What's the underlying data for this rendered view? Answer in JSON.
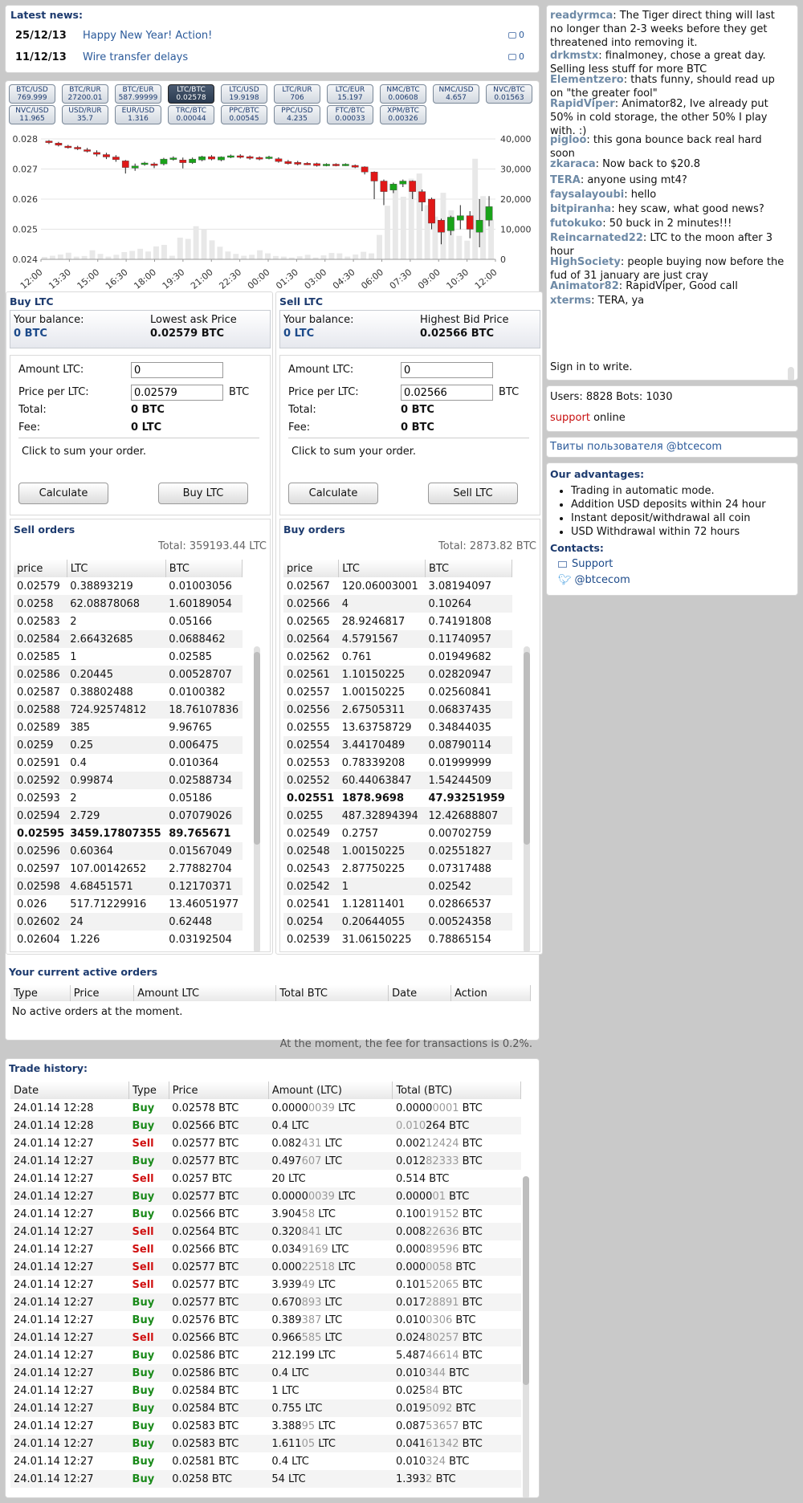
{
  "news": {
    "title": "Latest news:",
    "items": [
      {
        "date": "25/12/13",
        "text": "Happy New Year! Action!",
        "comments": "0"
      },
      {
        "date": "11/12/13",
        "text": "Wire transfer delays",
        "comments": "0"
      }
    ]
  },
  "pairs": [
    {
      "name": "BTC/USD",
      "price": "769.999"
    },
    {
      "name": "BTC/RUR",
      "price": "27200.01"
    },
    {
      "name": "BTC/EUR",
      "price": "587.99999"
    },
    {
      "name": "LTC/BTC",
      "price": "0.02578",
      "active": true
    },
    {
      "name": "LTC/USD",
      "price": "19.9198"
    },
    {
      "name": "LTC/RUR",
      "price": "706"
    },
    {
      "name": "LTC/EUR",
      "price": "15.197"
    },
    {
      "name": "NMC/BTC",
      "price": "0.00608"
    },
    {
      "name": "NMC/USD",
      "price": "4.657"
    },
    {
      "name": "NVC/BTC",
      "price": "0.01563"
    },
    {
      "name": "NVC/USD",
      "price": "11.965"
    },
    {
      "name": "USD/RUR",
      "price": "35.7"
    },
    {
      "name": "EUR/USD",
      "price": "1.316"
    },
    {
      "name": "TRC/BTC",
      "price": "0.00044"
    },
    {
      "name": "PPC/BTC",
      "price": "0.00545"
    },
    {
      "name": "PPC/USD",
      "price": "4.235"
    },
    {
      "name": "FTC/BTC",
      "price": "0.00033"
    },
    {
      "name": "XPM/BTC",
      "price": "0.00326"
    }
  ],
  "chart_data": {
    "type": "candlestick",
    "x_labels": [
      "12:00",
      "13:30",
      "15:00",
      "16:30",
      "18:00",
      "19:30",
      "21:00",
      "22:30",
      "00:00",
      "01:30",
      "03:00",
      "04:30",
      "06:00",
      "07:30",
      "09:00",
      "10:30",
      "12:00"
    ],
    "y_left_ticks": [
      "0.028",
      "0.027",
      "0.026",
      "0.025",
      "0.024"
    ],
    "y_left_range": [
      0.024,
      0.028
    ],
    "y_right_ticks": [
      "40,000",
      "30,000",
      "20,000",
      "10,000",
      "0"
    ],
    "y_right_range": [
      0,
      40000
    ],
    "candles": [
      [
        0.02793,
        0.02789,
        0.02796,
        0.02783
      ],
      [
        0.02786,
        0.02779,
        0.0279,
        0.02775
      ],
      [
        0.02776,
        0.02774,
        0.0278,
        0.02768
      ],
      [
        0.02772,
        0.02767,
        0.02777,
        0.02763
      ],
      [
        0.02764,
        0.02761,
        0.0277,
        0.02755
      ],
      [
        0.02755,
        0.02749,
        0.02762,
        0.02742
      ],
      [
        0.02748,
        0.0274,
        0.02754,
        0.02733
      ],
      [
        0.0274,
        0.02731,
        0.02746,
        0.02724
      ],
      [
        0.02727,
        0.02705,
        0.0273,
        0.02685
      ],
      [
        0.02703,
        0.0271,
        0.02718,
        0.02694
      ],
      [
        0.02716,
        0.0272,
        0.02724,
        0.02711
      ],
      [
        0.02717,
        0.02712,
        0.02722,
        0.02703
      ],
      [
        0.02717,
        0.02733,
        0.02737,
        0.02712
      ],
      [
        0.02733,
        0.02737,
        0.02742,
        0.02728
      ],
      [
        0.0273,
        0.02721,
        0.02738,
        0.02702
      ],
      [
        0.02721,
        0.02733,
        0.02738,
        0.02717
      ],
      [
        0.0273,
        0.02741,
        0.02744,
        0.02726
      ],
      [
        0.02741,
        0.02733,
        0.02746,
        0.02729
      ],
      [
        0.0273,
        0.0274,
        0.02742,
        0.02726
      ],
      [
        0.0274,
        0.02744,
        0.02748,
        0.02736
      ],
      [
        0.02744,
        0.0274,
        0.02749,
        0.02735
      ],
      [
        0.02741,
        0.02737,
        0.02745,
        0.02731
      ],
      [
        0.02738,
        0.02733,
        0.02742,
        0.02729
      ],
      [
        0.02736,
        0.0274,
        0.02744,
        0.02732
      ],
      [
        0.02734,
        0.02725,
        0.02739,
        0.02721
      ],
      [
        0.02725,
        0.02718,
        0.0273,
        0.02715
      ],
      [
        0.02722,
        0.02716,
        0.02727,
        0.02712
      ],
      [
        0.02719,
        0.02716,
        0.02723,
        0.02713
      ],
      [
        0.02718,
        0.02711,
        0.02721,
        0.02708
      ],
      [
        0.02712,
        0.02716,
        0.02719,
        0.02709
      ],
      [
        0.02716,
        0.02712,
        0.02719,
        0.02709
      ],
      [
        0.02713,
        0.02716,
        0.02719,
        0.0271
      ],
      [
        0.02712,
        0.02706,
        0.02715,
        0.02703
      ],
      [
        0.02707,
        0.0269,
        0.02709,
        0.02682
      ],
      [
        0.0269,
        0.0266,
        0.02692,
        0.026
      ],
      [
        0.0266,
        0.02625,
        0.02665,
        0.0258
      ],
      [
        0.0263,
        0.0265,
        0.02655,
        0.0262
      ],
      [
        0.0265,
        0.0266,
        0.02665,
        0.0264
      ],
      [
        0.0266,
        0.02625,
        0.02662,
        0.026
      ],
      [
        0.02625,
        0.0259,
        0.02632,
        0.0256
      ],
      [
        0.026,
        0.0252,
        0.02605,
        0.025
      ],
      [
        0.0253,
        0.0249,
        0.02535,
        0.0245
      ],
      [
        0.02495,
        0.0254,
        0.02545,
        0.0248
      ],
      [
        0.0253,
        0.02545,
        0.0258,
        0.025
      ],
      [
        0.02545,
        0.025,
        0.0256,
        0.0247
      ],
      [
        0.0249,
        0.0253,
        0.026,
        0.0244
      ],
      [
        0.0253,
        0.02575,
        0.0261,
        0.0251
      ]
    ],
    "volume": [
      800,
      1200,
      1600,
      2200,
      900,
      1100,
      3000,
      1800,
      900,
      1500,
      2400,
      2800,
      3500,
      2600,
      4300,
      4800,
      1200,
      7200,
      6800,
      11000,
      10000,
      6300,
      4200,
      2600,
      1800,
      1200,
      1500,
      3000,
      2000,
      1100,
      900,
      600,
      1000,
      1500,
      600,
      1300,
      2100,
      2000,
      900,
      1600,
      2500,
      2000,
      8100,
      17800,
      24500,
      20800,
      26800,
      28500,
      18000,
      14200,
      22100,
      16300,
      7800,
      6200,
      33400,
      21000,
      13200
    ]
  },
  "buy": {
    "title": "Buy LTC",
    "balance_label": "Your balance:",
    "balance_value": "0 BTC",
    "price_label": "Lowest ask Price",
    "price_value": "0.02579 BTC",
    "amount_label": "Amount LTC:",
    "amount_value": "0",
    "ppl_label": "Price per LTC:",
    "ppl_value": "0.02579",
    "btc": "BTC",
    "total_label": "Total:",
    "total_value": "0 BTC",
    "fee_label": "Fee:",
    "fee_value": "0 LTC",
    "hint": "Click to sum your order.",
    "calc": "Calculate",
    "action": "Buy LTC"
  },
  "sell": {
    "title": "Sell LTC",
    "balance_label": "Your balance:",
    "balance_value": "0 LTC",
    "price_label": "Highest Bid Price",
    "price_value": "0.02566 BTC",
    "amount_label": "Amount LTC:",
    "amount_value": "0",
    "ppl_label": "Price per LTC:",
    "ppl_value": "0.02566",
    "btc": "BTC",
    "total_label": "Total:",
    "total_value": "0 BTC",
    "fee_label": "Fee:",
    "fee_value": "0 BTC",
    "hint": "Click to sum your order.",
    "calc": "Calculate",
    "action": "Sell LTC"
  },
  "sell_orders": {
    "title": "Sell orders",
    "total": "Total: 359193.44 LTC",
    "headers": [
      "price",
      "LTC",
      "BTC"
    ],
    "rows": [
      [
        "0.02579",
        "0.38893219",
        "0.01003056"
      ],
      [
        "0.0258",
        "62.08878068",
        "1.60189054"
      ],
      [
        "0.02583",
        "2",
        "0.05166"
      ],
      [
        "0.02584",
        "2.66432685",
        "0.0688462"
      ],
      [
        "0.02585",
        "1",
        "0.02585"
      ],
      [
        "0.02586",
        "0.20445",
        "0.00528707"
      ],
      [
        "0.02587",
        "0.38802488",
        "0.0100382"
      ],
      [
        "0.02588",
        "724.92574812",
        "18.76107836"
      ],
      [
        "0.02589",
        "385",
        "9.96765"
      ],
      [
        "0.0259",
        "0.25",
        "0.006475"
      ],
      [
        "0.02591",
        "0.4",
        "0.010364"
      ],
      [
        "0.02592",
        "0.99874",
        "0.02588734"
      ],
      [
        "0.02593",
        "2",
        "0.05186"
      ],
      [
        "0.02594",
        "2.729",
        "0.07079026"
      ],
      [
        "0.02595",
        "3459.17807355",
        "89.765671"
      ],
      [
        "0.02596",
        "0.60364",
        "0.01567049"
      ],
      [
        "0.02597",
        "107.00142652",
        "2.77882704"
      ],
      [
        "0.02598",
        "4.68451571",
        "0.12170371"
      ],
      [
        "0.026",
        "517.71229916",
        "13.46051977"
      ],
      [
        "0.02602",
        "24",
        "0.62448"
      ],
      [
        "0.02604",
        "1.226",
        "0.03192504"
      ]
    ],
    "bold_row": 14
  },
  "buy_orders": {
    "title": "Buy orders",
    "total": "Total: 2873.82 BTC",
    "headers": [
      "price",
      "LTC",
      "BTC"
    ],
    "rows": [
      [
        "0.02567",
        "120.06003001",
        "3.08194097"
      ],
      [
        "0.02566",
        "4",
        "0.10264"
      ],
      [
        "0.02565",
        "28.9246817",
        "0.74191808"
      ],
      [
        "0.02564",
        "4.5791567",
        "0.11740957"
      ],
      [
        "0.02562",
        "0.761",
        "0.01949682"
      ],
      [
        "0.02561",
        "1.10150225",
        "0.02820947"
      ],
      [
        "0.02557",
        "1.00150225",
        "0.02560841"
      ],
      [
        "0.02556",
        "2.67505311",
        "0.06837435"
      ],
      [
        "0.02555",
        "13.63758729",
        "0.34844035"
      ],
      [
        "0.02554",
        "3.44170489",
        "0.08790114"
      ],
      [
        "0.02553",
        "0.78339208",
        "0.01999999"
      ],
      [
        "0.02552",
        "60.44063847",
        "1.54244509"
      ],
      [
        "0.02551",
        "1878.9698",
        "47.93251959"
      ],
      [
        "0.0255",
        "487.32894394",
        "12.42688807"
      ],
      [
        "0.02549",
        "0.2757",
        "0.00702759"
      ],
      [
        "0.02548",
        "1.00150225",
        "0.02551827"
      ],
      [
        "0.02543",
        "2.87750225",
        "0.07317488"
      ],
      [
        "0.02542",
        "1",
        "0.02542"
      ],
      [
        "0.02541",
        "1.12811401",
        "0.02866537"
      ],
      [
        "0.0254",
        "0.20644055",
        "0.00524358"
      ],
      [
        "0.02539",
        "31.06150225",
        "0.78865154"
      ]
    ],
    "bold_row": 12
  },
  "active": {
    "title": "Your current active orders",
    "headers": [
      "Type",
      "Price",
      "Amount LTC",
      "Total BTC",
      "Date",
      "Action"
    ],
    "empty": "No active orders at the moment."
  },
  "fee_note": "At the moment, the fee for transactions is 0.2%.",
  "history": {
    "title": "Trade history:",
    "headers": [
      "Date",
      "Type",
      "Price",
      "Amount (LTC)",
      "Total (BTC)"
    ],
    "rows": [
      [
        "24.01.14 12:28",
        "Buy",
        "0.02578 BTC",
        "0.0000",
        "0039",
        " LTC",
        "0.0000",
        "0001",
        " BTC"
      ],
      [
        "24.01.14 12:28",
        "Buy",
        "0.02566 BTC",
        "0.4 LTC",
        "",
        "",
        " ",
        "0.010",
        "264 BTC"
      ],
      [
        "24.01.14 12:27",
        "Sell",
        "0.02577 BTC",
        "0.082",
        "431",
        " LTC",
        "0.002",
        "12424",
        " BTC"
      ],
      [
        "24.01.14 12:27",
        "Buy",
        "0.02577 BTC",
        "0.497",
        "607",
        " LTC",
        "0.012",
        "82333",
        " BTC"
      ],
      [
        "24.01.14 12:27",
        "Sell",
        "0.0257 BTC",
        "20 LTC",
        "",
        "",
        "0.514 BTC",
        "",
        ""
      ],
      [
        "24.01.14 12:27",
        "Buy",
        "0.02577 BTC",
        "0.0000",
        "0039",
        " LTC",
        "0.0000",
        "01",
        " BTC"
      ],
      [
        "24.01.14 12:27",
        "Buy",
        "0.02566 BTC",
        "3.904",
        "58",
        " LTC",
        "0.100",
        "19152",
        " BTC"
      ],
      [
        "24.01.14 12:27",
        "Sell",
        "0.02564 BTC",
        "0.320",
        "841",
        " LTC",
        "0.008",
        "22636",
        " BTC"
      ],
      [
        "24.01.14 12:27",
        "Sell",
        "0.02566 BTC",
        "0.034",
        "9169",
        " LTC",
        "0.000",
        "89596",
        " BTC"
      ],
      [
        "24.01.14 12:27",
        "Sell",
        "0.02577 BTC",
        "0.000",
        "22518",
        " LTC",
        "0.000",
        "0058",
        " BTC"
      ],
      [
        "24.01.14 12:27",
        "Sell",
        "0.02577 BTC",
        "3.939",
        "49",
        " LTC",
        "0.101",
        "52065",
        " BTC"
      ],
      [
        "24.01.14 12:27",
        "Buy",
        "0.02577 BTC",
        "0.670",
        "893",
        " LTC",
        "0.017",
        "28891",
        " BTC"
      ],
      [
        "24.01.14 12:27",
        "Buy",
        "0.02576 BTC",
        "0.389",
        "387",
        " LTC",
        "0.010",
        "0306",
        " BTC"
      ],
      [
        "24.01.14 12:27",
        "Sell",
        "0.02566 BTC",
        "0.966",
        "585",
        " LTC",
        "0.024",
        "80257",
        " BTC"
      ],
      [
        "24.01.14 12:27",
        "Buy",
        "0.02586 BTC",
        "212.199 LTC",
        "",
        "",
        "5.487",
        "46614",
        " BTC"
      ],
      [
        "24.01.14 12:27",
        "Buy",
        "0.02586 BTC",
        "0.4 LTC",
        "",
        "",
        "0.010",
        "344",
        " BTC"
      ],
      [
        "24.01.14 12:27",
        "Buy",
        "0.02584 BTC",
        "1 LTC",
        "",
        "",
        "0.025",
        "84",
        " BTC"
      ],
      [
        "24.01.14 12:27",
        "Buy",
        "0.02584 BTC",
        "0.755 LTC",
        "",
        "",
        "0.019",
        "5092",
        " BTC"
      ],
      [
        "24.01.14 12:27",
        "Buy",
        "0.02583 BTC",
        "3.388",
        "95",
        " LTC",
        "0.087",
        "53657",
        " BTC"
      ],
      [
        "24.01.14 12:27",
        "Buy",
        "0.02583 BTC",
        "1.611",
        "05",
        " LTC",
        "0.041",
        "61342",
        " BTC"
      ],
      [
        "24.01.14 12:27",
        "Buy",
        "0.02581 BTC",
        "0.4 LTC",
        "",
        "",
        "0.010",
        "324",
        " BTC"
      ],
      [
        "24.01.14 12:27",
        "Buy",
        "0.0258 BTC",
        "54 LTC",
        "",
        "",
        "1.393",
        "2",
        " BTC"
      ]
    ]
  },
  "chat": {
    "lines": [
      {
        "name": "readyrmca",
        "text": "The Tiger direct thing will last no longer than 2-3 weeks before they get threatened into removing it."
      },
      {
        "name": "drkmstx",
        "text": "finalmoney, chose a great day. Selling less stuff for more BTC"
      },
      {
        "name": "Elementzero",
        "text": "thats funny, should read up on \"the greater fool\""
      },
      {
        "name": "RapidViper",
        "text": "Animator82, Ive already put 50% in cold storage, the other 50% I play with. :)"
      },
      {
        "name": "pigloo",
        "text": "this gona bounce back real hard soon"
      },
      {
        "name": "zkaraca",
        "text": "Now back to $20.8"
      },
      {
        "name": "TERA",
        "text": "anyone using mt4?"
      },
      {
        "name": "faysalayoubi",
        "text": "hello"
      },
      {
        "name": "bitpiranha",
        "text": "hey scaw, what good news?"
      },
      {
        "name": "futokuko",
        "text": "50 buck in 2 minutes!!!"
      },
      {
        "name": "Reincarnated22",
        "text": "LTC to the moon after 3 hour"
      },
      {
        "name": "HighSociety",
        "text": "people buying now before the fud of 31 january are just cray"
      },
      {
        "name": "Animator82",
        "text": "RapidViper, Good call"
      },
      {
        "name": "xterms",
        "text": "TERA, ya"
      }
    ],
    "signin": "Sign in to write."
  },
  "users": {
    "text": "Users: 8828 Bots: 1030",
    "support": "support",
    "online": "online"
  },
  "twitter": "Твиты пользователя @btcecom",
  "advantages": {
    "title": "Our advantages:",
    "items": [
      "Trading in automatic mode.",
      "Addition USD deposits within 24 hour",
      "Instant deposit/withdrawal all coin",
      "USD Withdrawal within 72 hours"
    ],
    "contacts_title": "Contacts:",
    "support": "Support",
    "twitter": "@btcecom"
  },
  "colors": {
    "up": "#1aa31a",
    "down": "#e01818",
    "volume": "#e8e8e8",
    "accent": "#1c3a6e"
  }
}
